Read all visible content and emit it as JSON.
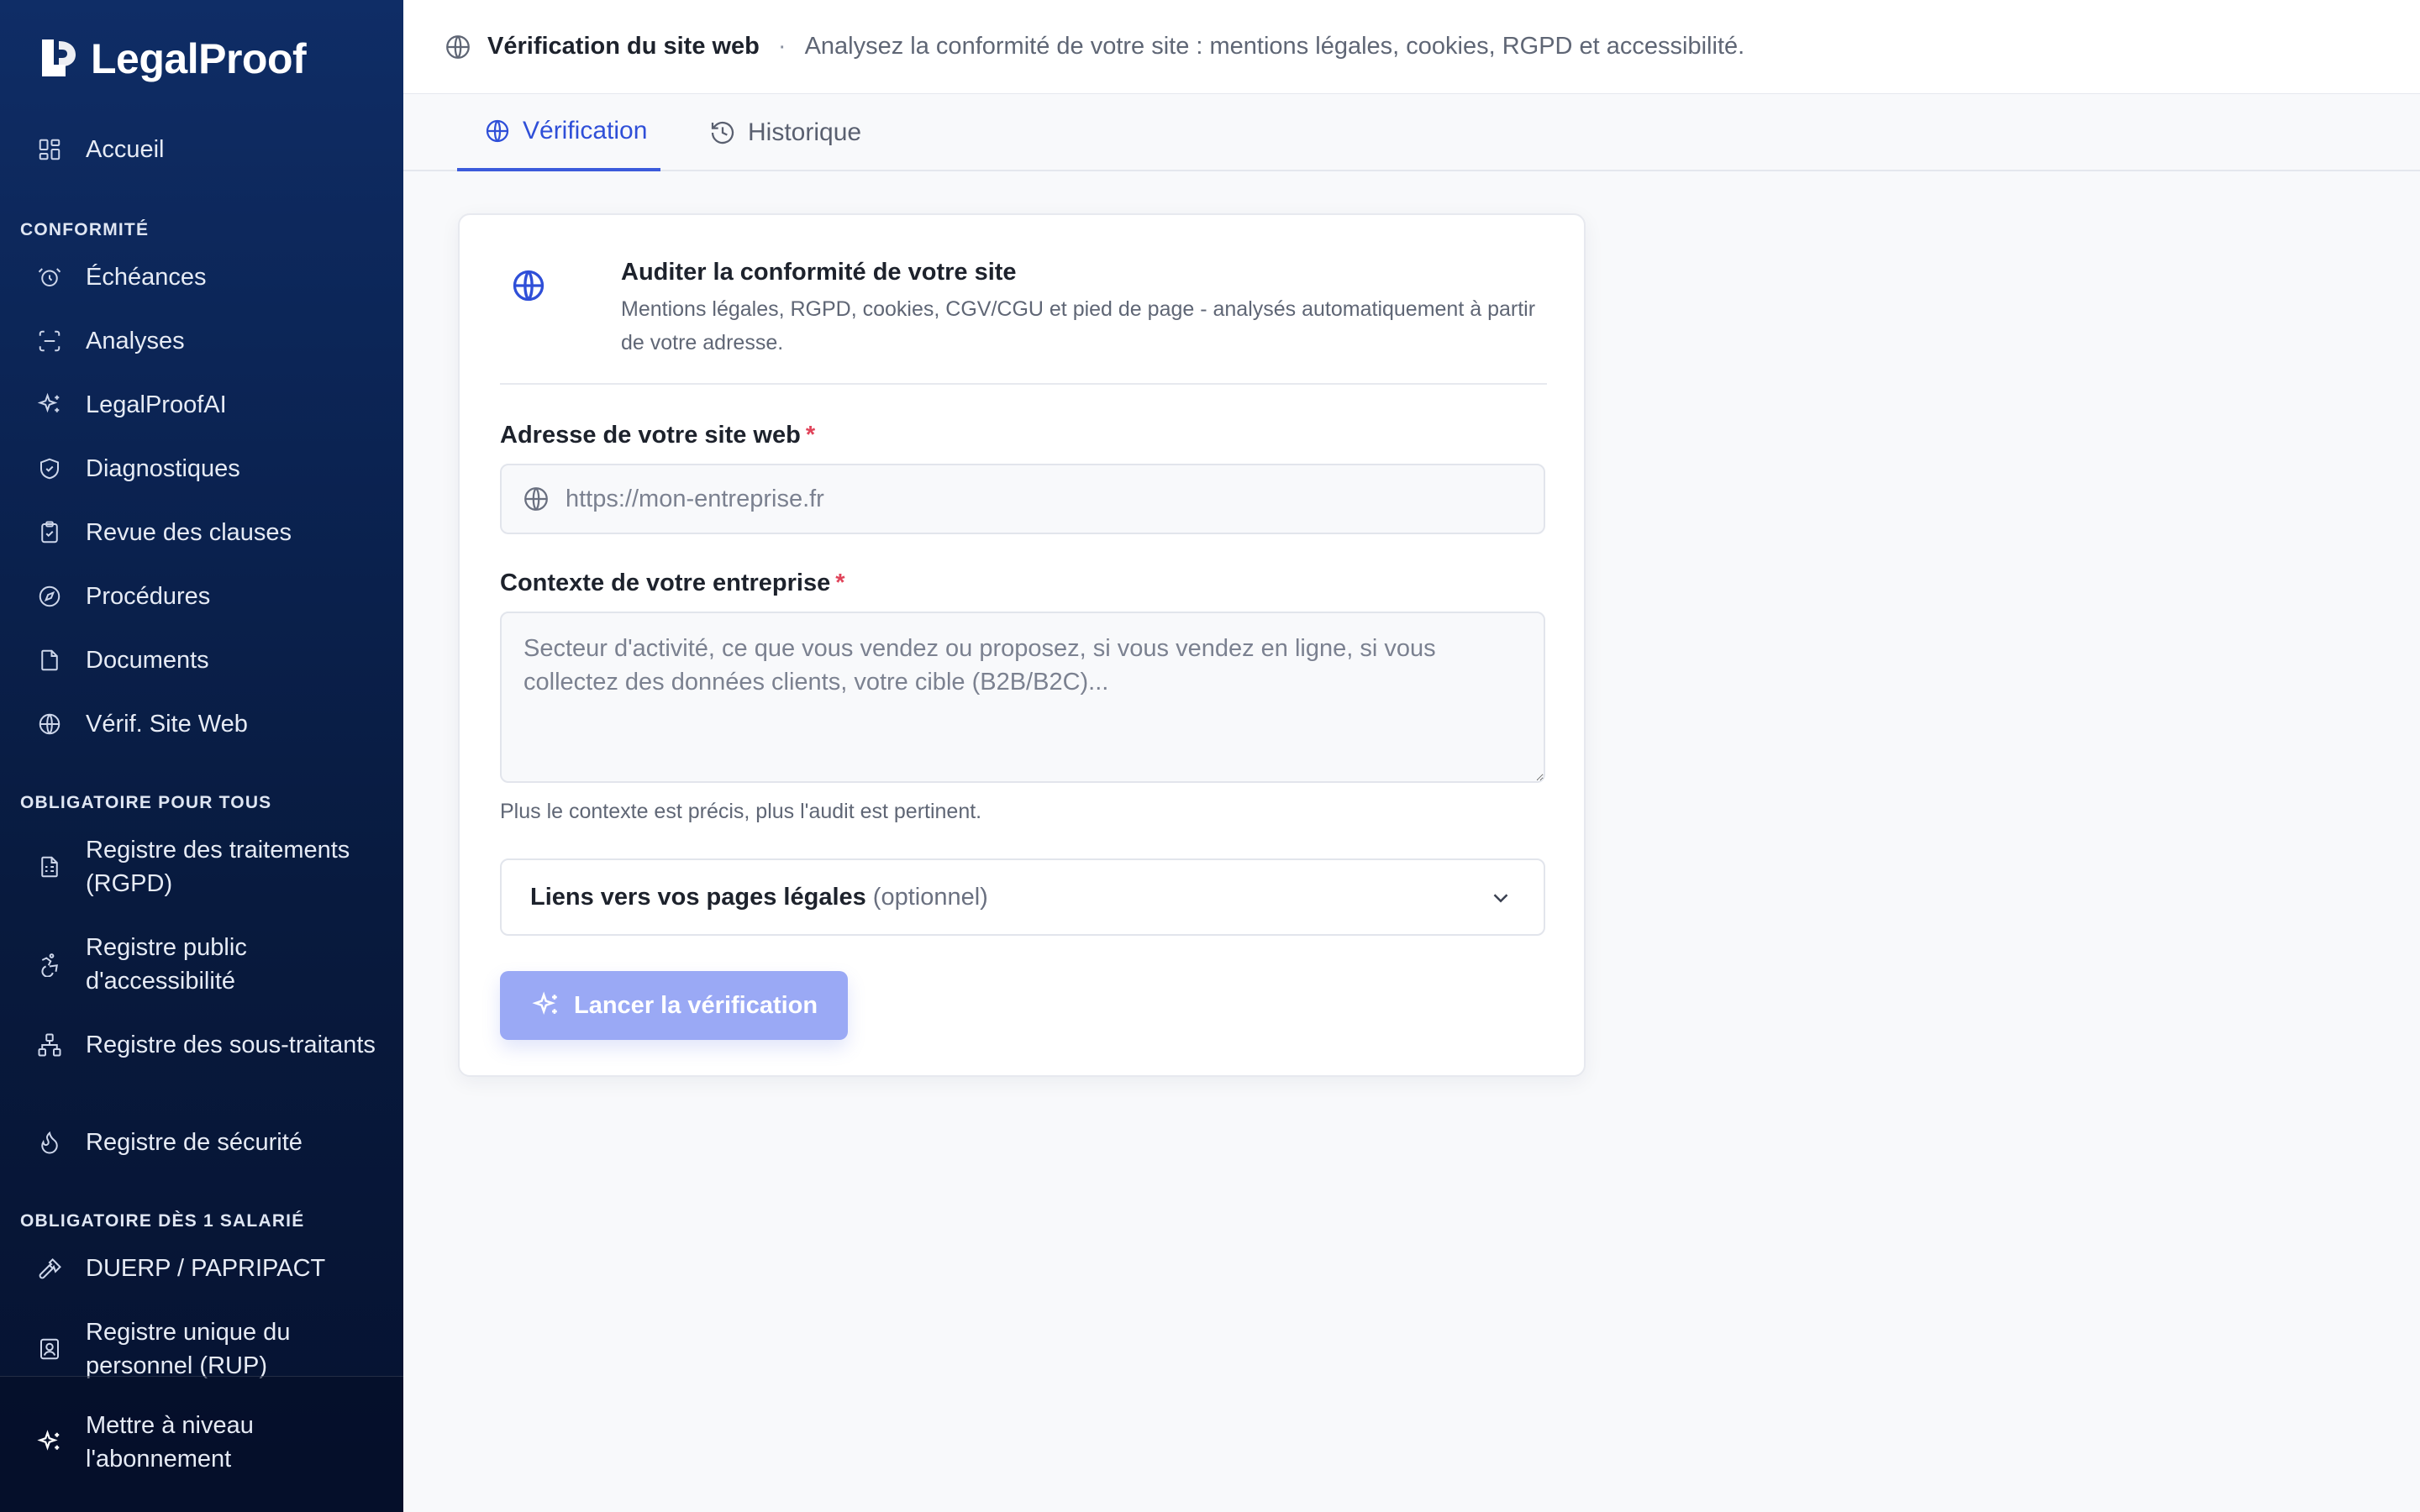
{
  "app": {
    "name": "LegalProof"
  },
  "sidebar": {
    "home": "Accueil",
    "sections": [
      {
        "title": "CONFORMITÉ"
      },
      {
        "title": "OBLIGATOIRE POUR TOUS"
      },
      {
        "title": "OBLIGATOIRE DÈS 1 SALARIÉ"
      }
    ],
    "items": [
      {
        "label": "Échéances",
        "icon": "alarm-clock-icon"
      },
      {
        "label": "Analyses",
        "icon": "scan-icon"
      },
      {
        "label": "LegalProofAI",
        "icon": "sparkles-icon"
      },
      {
        "label": "Diagnostiques",
        "icon": "shield-check-icon"
      },
      {
        "label": "Revue des clauses",
        "icon": "clipboard-check-icon"
      },
      {
        "label": "Procédures",
        "icon": "compass-icon"
      },
      {
        "label": "Documents",
        "icon": "file-icon"
      },
      {
        "label": "Vérif. Site Web",
        "icon": "globe-icon"
      },
      {
        "label": "Registre des traitements (RGPD)",
        "icon": "file-spreadsheet-icon"
      },
      {
        "label": "Registre public d'accessibilité",
        "icon": "accessibility-icon"
      },
      {
        "label": "Registre des sous-traitants",
        "icon": "network-icon"
      },
      {
        "label": "Registre de sécurité",
        "icon": "flame-icon"
      },
      {
        "label": "DUERP / PAPRIPACT",
        "icon": "hammer-icon"
      },
      {
        "label": "Registre unique du personnel (RUP)",
        "icon": "contact-icon"
      }
    ],
    "upgrade": "Mettre à niveau l'abonnement"
  },
  "header": {
    "title": "Vérification du site web",
    "separator": "·",
    "subtitle": "Analysez la conformité de votre site : mentions légales, cookies, RGPD et accessibilité."
  },
  "tabs": [
    {
      "label": "Vérification",
      "active": true
    },
    {
      "label": "Historique",
      "active": false
    }
  ],
  "card": {
    "title": "Auditer la conformité de votre site",
    "description": "Mentions légales, RGPD, cookies, CGV/CGU et pied de page - analysés automatiquement à partir de votre adresse.",
    "url_field": {
      "label": "Adresse de votre site web",
      "required_mark": "*",
      "placeholder": "https://mon-entreprise.fr",
      "value": ""
    },
    "context_field": {
      "label": "Contexte de votre entreprise",
      "required_mark": "*",
      "placeholder": "Secteur d'activité, ce que vous vendez ou proposez, si vous vendez en ligne, si vous collectez des données clients, votre cible (B2B/B2C)...",
      "value": ""
    },
    "hint": "Plus le contexte est précis, plus l'audit est pertinent.",
    "accordion": {
      "title": "Liens vers vos pages légales",
      "optional": "(optionnel)"
    },
    "submit_label": "Lancer la vérification"
  },
  "colors": {
    "accent": "#3b5bdb",
    "button_disabled": "#9aa9f5",
    "sidebar_top": "#0f2d66",
    "sidebar_bottom": "#061230",
    "required": "#e0445a"
  }
}
